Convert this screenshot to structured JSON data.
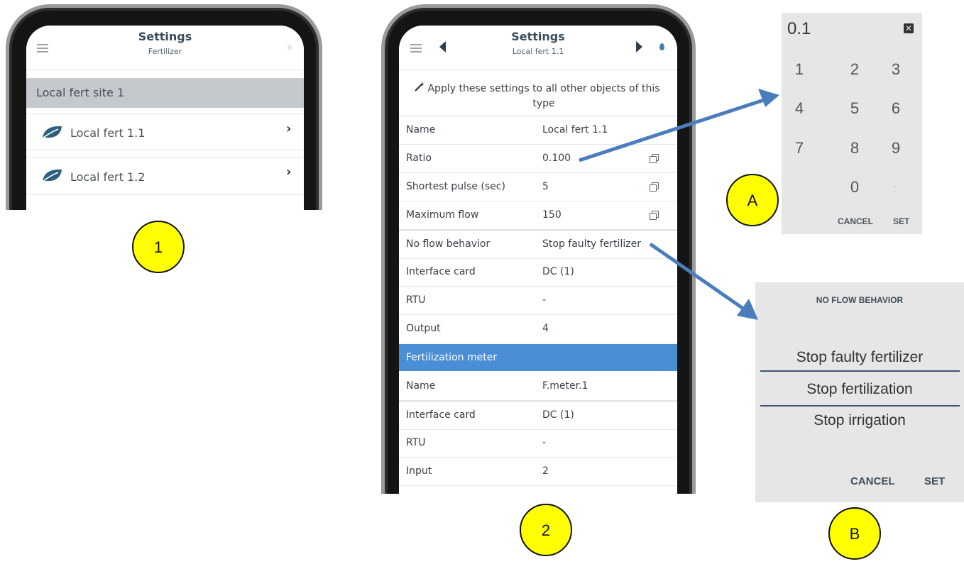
{
  "screen1": {
    "title": "Settings",
    "subtitle": "Fertilizer",
    "group_label": "Local fert site 1",
    "items": [
      {
        "label": "Local fert 1.1"
      },
      {
        "label": "Local fert 1.2"
      }
    ]
  },
  "screen2": {
    "title": "Settings",
    "subtitle": "Local fert 1.1",
    "apply_text": "Apply these settings to all other objects of this type",
    "rows": [
      {
        "label": "Name",
        "value": "Local fert 1.1"
      },
      {
        "label": "Ratio",
        "value": "0.100"
      },
      {
        "label": "Shortest pulse (sec)",
        "value": "5"
      },
      {
        "label": "Maximum flow",
        "value": "150"
      },
      {
        "label": "No flow behavior",
        "value": "Stop faulty fertilizer"
      },
      {
        "label": "Interface card",
        "value": "DC (1)"
      },
      {
        "label": "RTU",
        "value": "-"
      },
      {
        "label": "Output",
        "value": "4"
      }
    ],
    "section_header": "Fertilization meter",
    "meter_rows": [
      {
        "label": "Name",
        "value": "F.meter.1"
      },
      {
        "label": "Interface card",
        "value": "DC (1)"
      },
      {
        "label": "RTU",
        "value": "-"
      },
      {
        "label": "Input",
        "value": "2"
      }
    ]
  },
  "numpad": {
    "display": "0.1",
    "keys": [
      "1",
      "2",
      "3",
      "4",
      "5",
      "6",
      "7",
      "8",
      "9",
      "0",
      "."
    ],
    "cancel_label": "CANCEL",
    "set_label": "SET"
  },
  "picker": {
    "title": "NO FLOW BEHAVIOR",
    "options": [
      "Stop faulty fertilizer",
      "Stop fertilization",
      "Stop irrigation"
    ],
    "cancel_label": "CANCEL",
    "set_label": "SET"
  },
  "badges": {
    "one": "1",
    "two": "2",
    "a": "A",
    "b": "B"
  },
  "colors": {
    "badge_fill": "#ffff00",
    "arrow": "#4a7dbd",
    "section_header": "#4a8fd6",
    "selected_row": "#c4c9ce",
    "leaf_icon": "#2e5f7e"
  }
}
